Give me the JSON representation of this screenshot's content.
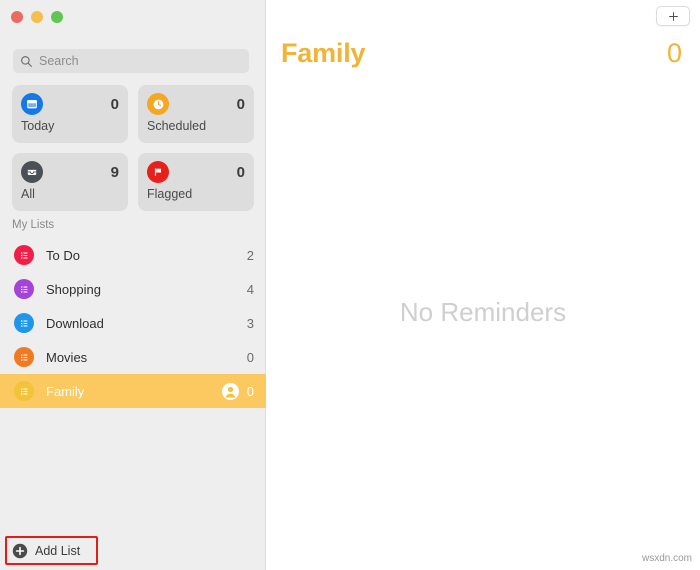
{
  "window": {
    "traffic_lights": [
      {
        "name": "close-button",
        "color": "#ec6a5f"
      },
      {
        "name": "minimize-button",
        "color": "#f4bf4f"
      },
      {
        "name": "maximize-button",
        "color": "#61c554"
      }
    ]
  },
  "sidebar": {
    "search": {
      "placeholder": "Search",
      "value": "",
      "icon": "search-icon"
    },
    "smart_lists": [
      {
        "label": "Today",
        "count": "0",
        "icon": "calendar-icon",
        "color": "#1578e8"
      },
      {
        "label": "Scheduled",
        "count": "0",
        "icon": "clock-icon",
        "color": "#f5a623"
      },
      {
        "label": "All",
        "count": "9",
        "icon": "inbox-icon",
        "color": "#4b4f56"
      },
      {
        "label": "Flagged",
        "count": "0",
        "icon": "flag-icon",
        "color": "#e8201b"
      }
    ],
    "section_title": "My Lists",
    "lists": [
      {
        "label": "To Do",
        "count": "2",
        "color": "#f01f49",
        "selected": false,
        "shared": false
      },
      {
        "label": "Shopping",
        "count": "4",
        "color": "#a343d8",
        "selected": false,
        "shared": false
      },
      {
        "label": "Download",
        "count": "3",
        "color": "#2196e8",
        "selected": false,
        "shared": false
      },
      {
        "label": "Movies",
        "count": "0",
        "color": "#ef7a22",
        "selected": false,
        "shared": false
      },
      {
        "label": "Family",
        "count": "0",
        "color": "#f3c33c",
        "selected": true,
        "shared": true
      }
    ],
    "add_list": {
      "label": "Add List",
      "icon": "plus-circle-icon",
      "highlight_color": "#e01f15"
    }
  },
  "main": {
    "add_reminder_button": {
      "icon": "plus-icon",
      "label": "+"
    },
    "title": "Family",
    "count": "0",
    "empty_state": "No Reminders",
    "accent_color": "#f0b437"
  },
  "watermark": "wsxdn.com"
}
